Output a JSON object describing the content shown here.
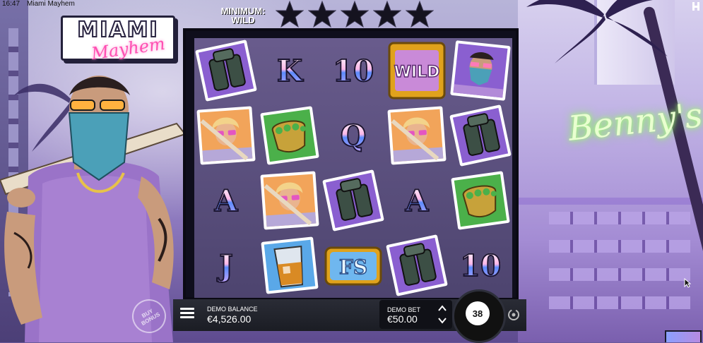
{
  "statusbar": {
    "time": "16:47",
    "title": "Miami Mayhem"
  },
  "logo": {
    "line1": "MIAMI",
    "line2": "Mayhem"
  },
  "header": {
    "min_wild_label": "MINIMUM: WILD",
    "stars_total": 5,
    "stars_filled": 0
  },
  "scene": {
    "sign_text": "Benny's"
  },
  "reels": {
    "columns": 5,
    "rows": 4,
    "grid": [
      [
        "binoculars",
        "K",
        "10",
        "wild",
        "bandit"
      ],
      [
        "woman",
        "knuckles",
        "Q",
        "woman",
        "binoculars"
      ],
      [
        "A",
        "woman",
        "binoculars",
        "A",
        "knuckles"
      ],
      [
        "J",
        "whiskey",
        "fs",
        "binoculars",
        "10"
      ]
    ],
    "wild_label": "WILD",
    "fs_label": "FS"
  },
  "controls": {
    "buy_bonus_label": "BUY BONUS",
    "balance_label": "DEMO BALANCE",
    "balance_value": "€4,526.00",
    "bet_label": "DEMO BET",
    "bet_value": "€50.00",
    "spin_count": "38"
  },
  "colors": {
    "accent_pink": "#ff4fb2",
    "neon_green": "#7dff45",
    "gold": "#e0a21c"
  }
}
